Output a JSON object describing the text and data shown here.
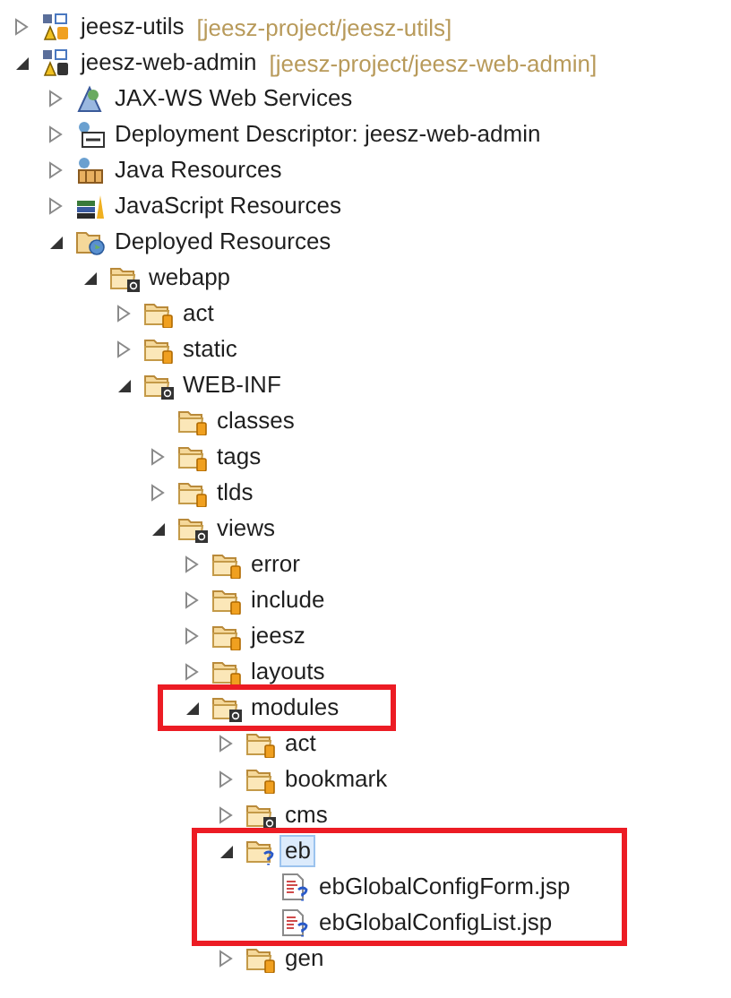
{
  "tree": [
    {
      "label": "jeesz-utils",
      "path": "[jeesz-project/jeesz-utils]",
      "kind": "project",
      "expanded": false,
      "selected": false
    },
    {
      "label": "jeesz-web-admin",
      "path": "[jeesz-project/jeesz-web-admin]",
      "kind": "webproject",
      "expanded": true,
      "selected": false,
      "children": [
        {
          "label": "JAX-WS Web Services",
          "kind": "webservices",
          "expanded": false,
          "selected": false
        },
        {
          "label": "Deployment Descriptor: jeesz-web-admin",
          "kind": "descriptor",
          "expanded": false,
          "selected": false
        },
        {
          "label": "Java Resources",
          "kind": "javaresources",
          "expanded": false,
          "selected": false
        },
        {
          "label": "JavaScript Resources",
          "kind": "jsresources",
          "expanded": false,
          "selected": false
        },
        {
          "label": "Deployed Resources",
          "kind": "deployed",
          "expanded": true,
          "selected": false,
          "children": [
            {
              "label": "webapp",
              "kind": "webfolder",
              "expanded": true,
              "selected": false,
              "children": [
                {
                  "label": "act",
                  "kind": "folder",
                  "expanded": false,
                  "selected": false
                },
                {
                  "label": "static",
                  "kind": "folder",
                  "expanded": false,
                  "selected": false
                },
                {
                  "label": "WEB-INF",
                  "kind": "webfolder",
                  "expanded": true,
                  "selected": false,
                  "children": [
                    {
                      "label": "classes",
                      "kind": "folder",
                      "selected": false
                    },
                    {
                      "label": "tags",
                      "kind": "folder",
                      "expanded": false,
                      "selected": false
                    },
                    {
                      "label": "tlds",
                      "kind": "folder",
                      "expanded": false,
                      "selected": false
                    },
                    {
                      "label": "views",
                      "kind": "webfolder",
                      "expanded": true,
                      "selected": false,
                      "children": [
                        {
                          "label": "error",
                          "kind": "folder",
                          "expanded": false,
                          "selected": false
                        },
                        {
                          "label": "include",
                          "kind": "folder",
                          "expanded": false,
                          "selected": false
                        },
                        {
                          "label": "jeesz",
                          "kind": "folder",
                          "expanded": false,
                          "selected": false
                        },
                        {
                          "label": "layouts",
                          "kind": "folder",
                          "expanded": false,
                          "selected": false
                        },
                        {
                          "label": "modules",
                          "kind": "webfolder",
                          "expanded": true,
                          "selected": false,
                          "highlighted": true,
                          "highlight_includes_children": false,
                          "children": [
                            {
                              "label": "act",
                              "kind": "folder",
                              "expanded": false,
                              "selected": false
                            },
                            {
                              "label": "bookmark",
                              "kind": "folder",
                              "expanded": false,
                              "selected": false
                            },
                            {
                              "label": "cms",
                              "kind": "webfolder",
                              "expanded": false,
                              "selected": false
                            },
                            {
                              "label": "eb",
                              "kind": "unknownfolder",
                              "expanded": true,
                              "selected": true,
                              "highlighted": true,
                              "highlight_includes_children": true,
                              "children": [
                                {
                                  "label": "ebGlobalConfigForm.jsp",
                                  "kind": "unknownfile",
                                  "selected": false
                                },
                                {
                                  "label": "ebGlobalConfigList.jsp",
                                  "kind": "unknownfile",
                                  "selected": false
                                }
                              ]
                            },
                            {
                              "label": "gen",
                              "kind": "folder",
                              "expanded": false,
                              "selected": false
                            }
                          ]
                        }
                      ]
                    }
                  ]
                }
              ]
            }
          ]
        }
      ]
    }
  ]
}
